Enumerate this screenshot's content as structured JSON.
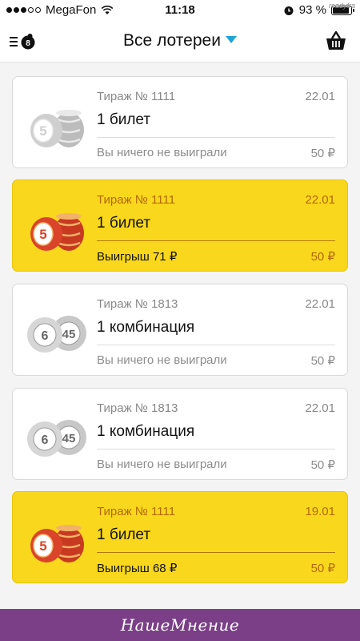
{
  "status_bar": {
    "carrier": "MegaFon",
    "time": "11:18",
    "battery": "93 %",
    "battery_level": 0.93,
    "watermark": "readyfra"
  },
  "nav": {
    "title": "Все лотереи",
    "accent": "#1fa5d8"
  },
  "tickets": [
    {
      "draw": "Тираж № 1111",
      "date": "22.01",
      "name": "1 билет",
      "result": "Вы ничего не выиграли",
      "price": "50 ₽",
      "won": false,
      "icon": "keg-icon"
    },
    {
      "draw": "Тираж № 1111",
      "date": "22.01",
      "name": "1 билет",
      "result": "Выигрыш 71 ₽",
      "price": "50 ₽",
      "won": true,
      "icon": "keg-icon"
    },
    {
      "draw": "Тираж № 1813",
      "date": "22.01",
      "name": "1 комбинация",
      "result": "Вы ничего не выиграли",
      "price": "50 ₽",
      "won": false,
      "icon": "balls-6-45-icon"
    },
    {
      "draw": "Тираж № 1813",
      "date": "22.01",
      "name": "1 комбинация",
      "result": "Вы ничего не выиграли",
      "price": "50 ₽",
      "won": false,
      "icon": "balls-6-45-icon"
    },
    {
      "draw": "Тираж № 1111",
      "date": "19.01",
      "name": "1 билет",
      "result": "Выигрыш 68 ₽",
      "price": "50 ₽",
      "won": true,
      "icon": "keg-icon"
    }
  ],
  "colors": {
    "win_card": "#f9d71c",
    "win_text": "#b06a06",
    "keg_red": "#d9442a"
  },
  "footer": {
    "text": "НашеМнение",
    "bg": "#7a3f86"
  }
}
